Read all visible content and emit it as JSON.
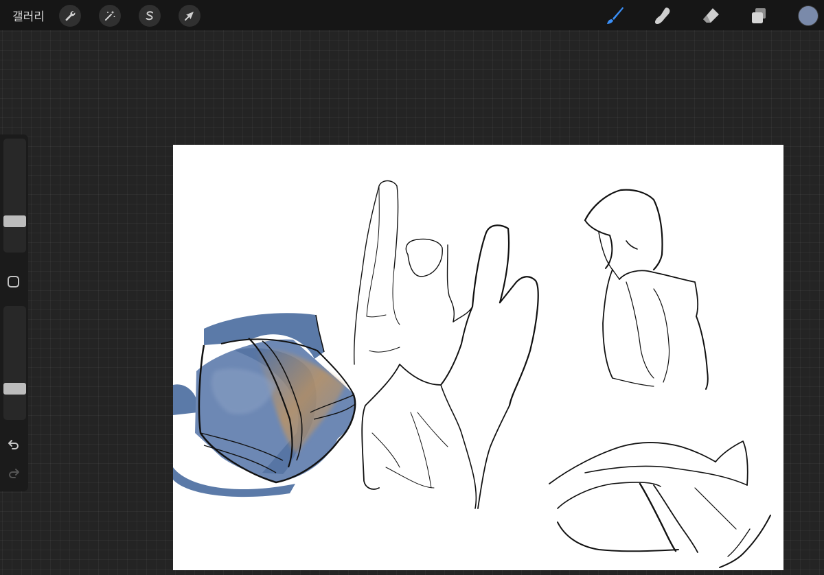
{
  "app": {
    "gallery_label": "갤러리"
  },
  "colors": {
    "workspace_bg": "#242424",
    "topbar_bg": "#161616",
    "brush_active": "#3a8ff7",
    "icon_gray": "#cfcfcf",
    "current_color": "#7a8aaa",
    "bag_blue": "#5b7aa8",
    "bag_ochre": "#c4955c",
    "ink": "#111111"
  },
  "toolbar_left": {
    "tools": [
      {
        "name": "actions",
        "icon": "wrench-icon"
      },
      {
        "name": "adjustments",
        "icon": "magic-wand-icon"
      },
      {
        "name": "selection",
        "icon": "selection-s-icon"
      },
      {
        "name": "transform",
        "icon": "arrow-cursor-icon"
      }
    ]
  },
  "toolbar_right": {
    "tools": [
      {
        "name": "brush",
        "icon": "brush-icon",
        "active": true
      },
      {
        "name": "smudge",
        "icon": "smudge-finger-icon",
        "active": false
      },
      {
        "name": "eraser",
        "icon": "eraser-icon",
        "active": false
      },
      {
        "name": "layers",
        "icon": "layers-icon",
        "active": false
      }
    ]
  },
  "sidebar": {
    "brush_size_level": 0.25,
    "opacity_level": 0.25,
    "buttons": [
      "modify-square-icon",
      "undo-icon",
      "redo-icon"
    ],
    "redo_enabled": false
  },
  "canvas": {
    "artwork": [
      "shoulder-bag-sketch",
      "hand-sketch",
      "hooded-figure-sketch",
      "folded-cloth-sketch"
    ]
  }
}
